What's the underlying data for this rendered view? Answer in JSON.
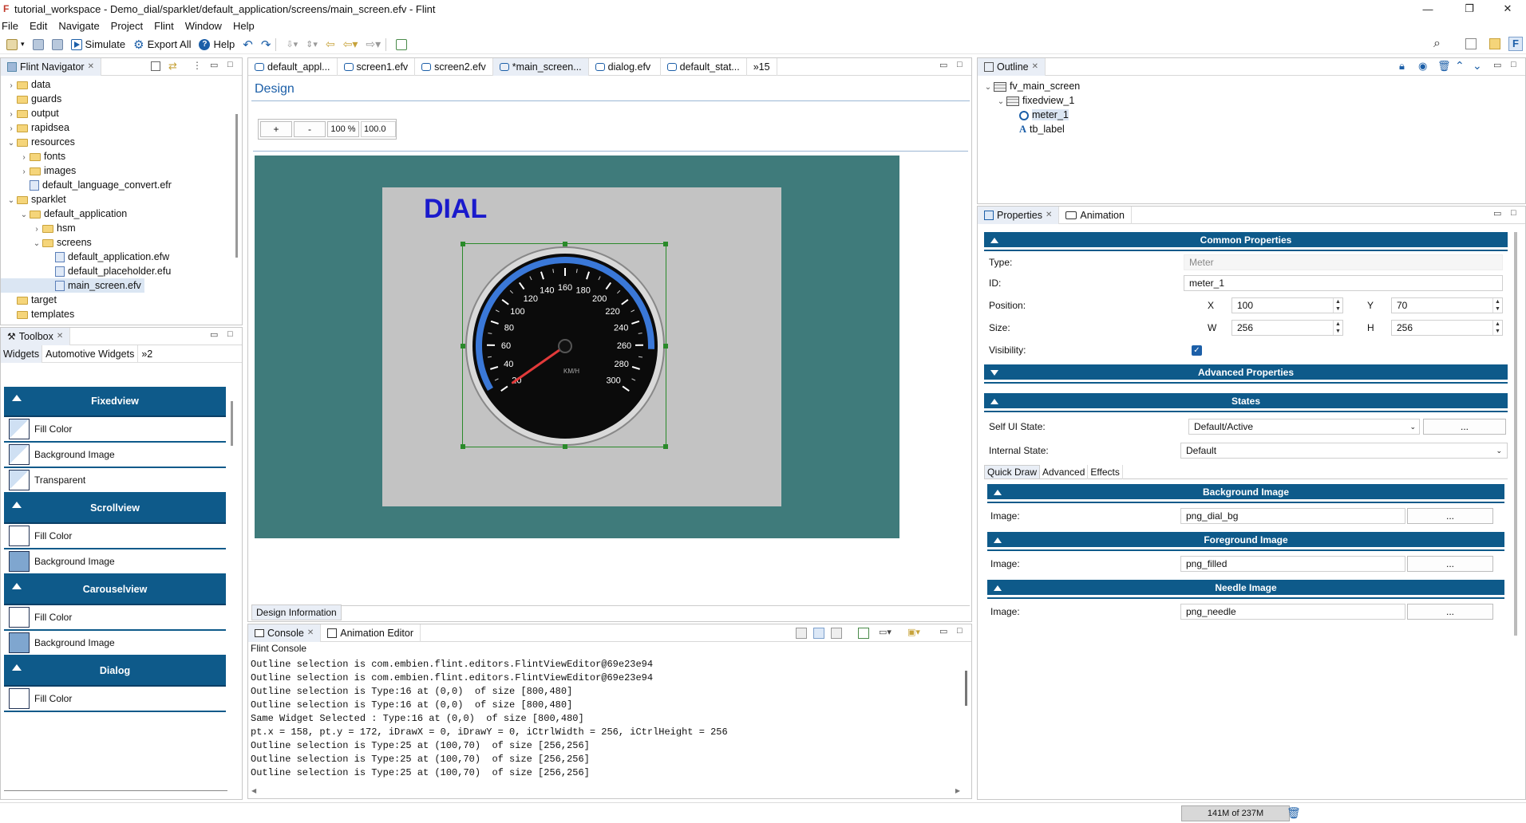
{
  "window": {
    "title": "tutorial_workspace - Demo_dial/sparklet/default_application/screens/main_screen.efv - Flint",
    "controls": [
      "—",
      "❐",
      "✕"
    ]
  },
  "menu": [
    "File",
    "Edit",
    "Navigate",
    "Project",
    "Flint",
    "Window",
    "Help"
  ],
  "toolbar": {
    "simulate": "Simulate",
    "export_all": "Export All",
    "help": "Help"
  },
  "navigator": {
    "title": "Flint Navigator",
    "items": [
      {
        "label": "data",
        "level": 1,
        "kind": "folder",
        "expanded": false
      },
      {
        "label": "guards",
        "level": 1,
        "kind": "folder",
        "expanded": null
      },
      {
        "label": "output",
        "level": 1,
        "kind": "folder",
        "expanded": false
      },
      {
        "label": "rapidsea",
        "level": 1,
        "kind": "folder",
        "expanded": false
      },
      {
        "label": "resources",
        "level": 1,
        "kind": "folder",
        "expanded": true
      },
      {
        "label": "fonts",
        "level": 2,
        "kind": "folder",
        "expanded": false
      },
      {
        "label": "images",
        "level": 2,
        "kind": "folder",
        "expanded": false
      },
      {
        "label": "default_language_convert.efr",
        "level": 2,
        "kind": "file",
        "expanded": null
      },
      {
        "label": "sparklet",
        "level": 1,
        "kind": "folder",
        "expanded": true
      },
      {
        "label": "default_application",
        "level": 2,
        "kind": "folder",
        "expanded": true
      },
      {
        "label": "hsm",
        "level": 3,
        "kind": "folder",
        "expanded": false
      },
      {
        "label": "screens",
        "level": 3,
        "kind": "folder",
        "expanded": true
      },
      {
        "label": "default_application.efw",
        "level": 4,
        "kind": "file",
        "expanded": null
      },
      {
        "label": "default_placeholder.efu",
        "level": 4,
        "kind": "file",
        "expanded": null
      },
      {
        "label": "main_screen.efv",
        "level": 4,
        "kind": "file",
        "expanded": null,
        "selected": true
      },
      {
        "label": "target",
        "level": 1,
        "kind": "folder",
        "expanded": null
      },
      {
        "label": "templates",
        "level": 1,
        "kind": "folder",
        "expanded": null
      }
    ]
  },
  "toolbox": {
    "title": "Toolbox",
    "tabs": [
      "Widgets",
      "Automotive Widgets",
      "»2"
    ],
    "groups": [
      {
        "name": "Fixedview",
        "items": [
          "Fill Color",
          "Background Image",
          "Transparent"
        ]
      },
      {
        "name": "Scrollview",
        "items": [
          "Fill Color",
          "Background Image"
        ]
      },
      {
        "name": "Carouselview",
        "items": [
          "Fill Color",
          "Background Image"
        ]
      },
      {
        "name": "Dialog",
        "items": [
          "Fill Color"
        ]
      }
    ]
  },
  "editor": {
    "tabs": [
      "default_appl...",
      "screen1.efv",
      "screen2.efv",
      "*main_screen...",
      "dialog.efv",
      "default_stat...",
      "»15"
    ],
    "active_tab": "*main_screen...",
    "design_title": "Design",
    "zoom_in": "+",
    "zoom_out": "-",
    "zoom_percent": "100 %",
    "zoom_value": "100.0",
    "canvas_label": "DIAL",
    "bottom_tab": "Design Information",
    "gauge": {
      "ticks": [
        "20",
        "40",
        "60",
        "80",
        "100",
        "120",
        "140",
        "160",
        "180",
        "200",
        "220",
        "240",
        "260",
        "280",
        "300"
      ],
      "unit": "KM/H",
      "needle_value": 20
    }
  },
  "console": {
    "tabs": [
      "Console",
      "Animation Editor"
    ],
    "name": "Flint Console",
    "lines": [
      "Outline selection is com.embien.flint.editors.FlintViewEditor@69e23e94",
      "Outline selection is com.embien.flint.editors.FlintViewEditor@69e23e94",
      "Outline selection is Type:16 at (0,0)  of size [800,480]",
      "Outline selection is Type:16 at (0,0)  of size [800,480]",
      "Same Widget Selected : Type:16 at (0,0)  of size [800,480]",
      "pt.x = 158, pt.y = 172, iDrawX = 0, iDrawY = 0, iCtrlWidth = 256, iCtrlHeight = 256",
      "Outline selection is Type:25 at (100,70)  of size [256,256]",
      "Outline selection is Type:25 at (100,70)  of size [256,256]",
      "Outline selection is Type:25 at (100,70)  of size [256,256]",
      "Outline selection is Type:25 at (100,70)  of size [256,256]"
    ]
  },
  "outline": {
    "title": "Outline",
    "items": [
      {
        "label": "fv_main_screen",
        "level": 0
      },
      {
        "label": "fixedview_1",
        "level": 1
      },
      {
        "label": "meter_1",
        "level": 2,
        "selected": true
      },
      {
        "label": "tb_label",
        "level": 2
      }
    ]
  },
  "properties": {
    "tabs": [
      "Properties",
      "Animation"
    ],
    "common_header": "Common Properties",
    "type_label": "Type:",
    "type_value": "Meter",
    "id_label": "ID:",
    "id_value": "meter_1",
    "position_label": "Position:",
    "x_label": "X",
    "x_value": "100",
    "y_label": "Y",
    "y_value": "70",
    "size_label": "Size:",
    "w_label": "W",
    "w_value": "256",
    "h_label": "H",
    "h_value": "256",
    "visibility_label": "Visibility:",
    "visibility_checked": true,
    "advanced_header": "Advanced Properties",
    "states_header": "States",
    "self_ui_label": "Self UI State:",
    "self_ui_value": "Default/Active",
    "internal_label": "Internal State:",
    "internal_value": "Default",
    "ellipsis": "...",
    "subtabs": [
      "Quick Draw",
      "Advanced",
      "Effects"
    ],
    "bg_header": "Background Image",
    "fg_header": "Foreground Image",
    "needle_header": "Needle Image",
    "image_label": "Image:",
    "bg_image": "png_dial_bg",
    "fg_image": "png_filled",
    "needle_image": "png_needle"
  },
  "status": {
    "memory": "141M of 237M"
  },
  "colors": {
    "accent_blue": "#0e5a8a",
    "canvas_teal": "#3f7b7b",
    "canvas_gray": "#c3c3c3",
    "dial_title": "#1a1acc"
  }
}
